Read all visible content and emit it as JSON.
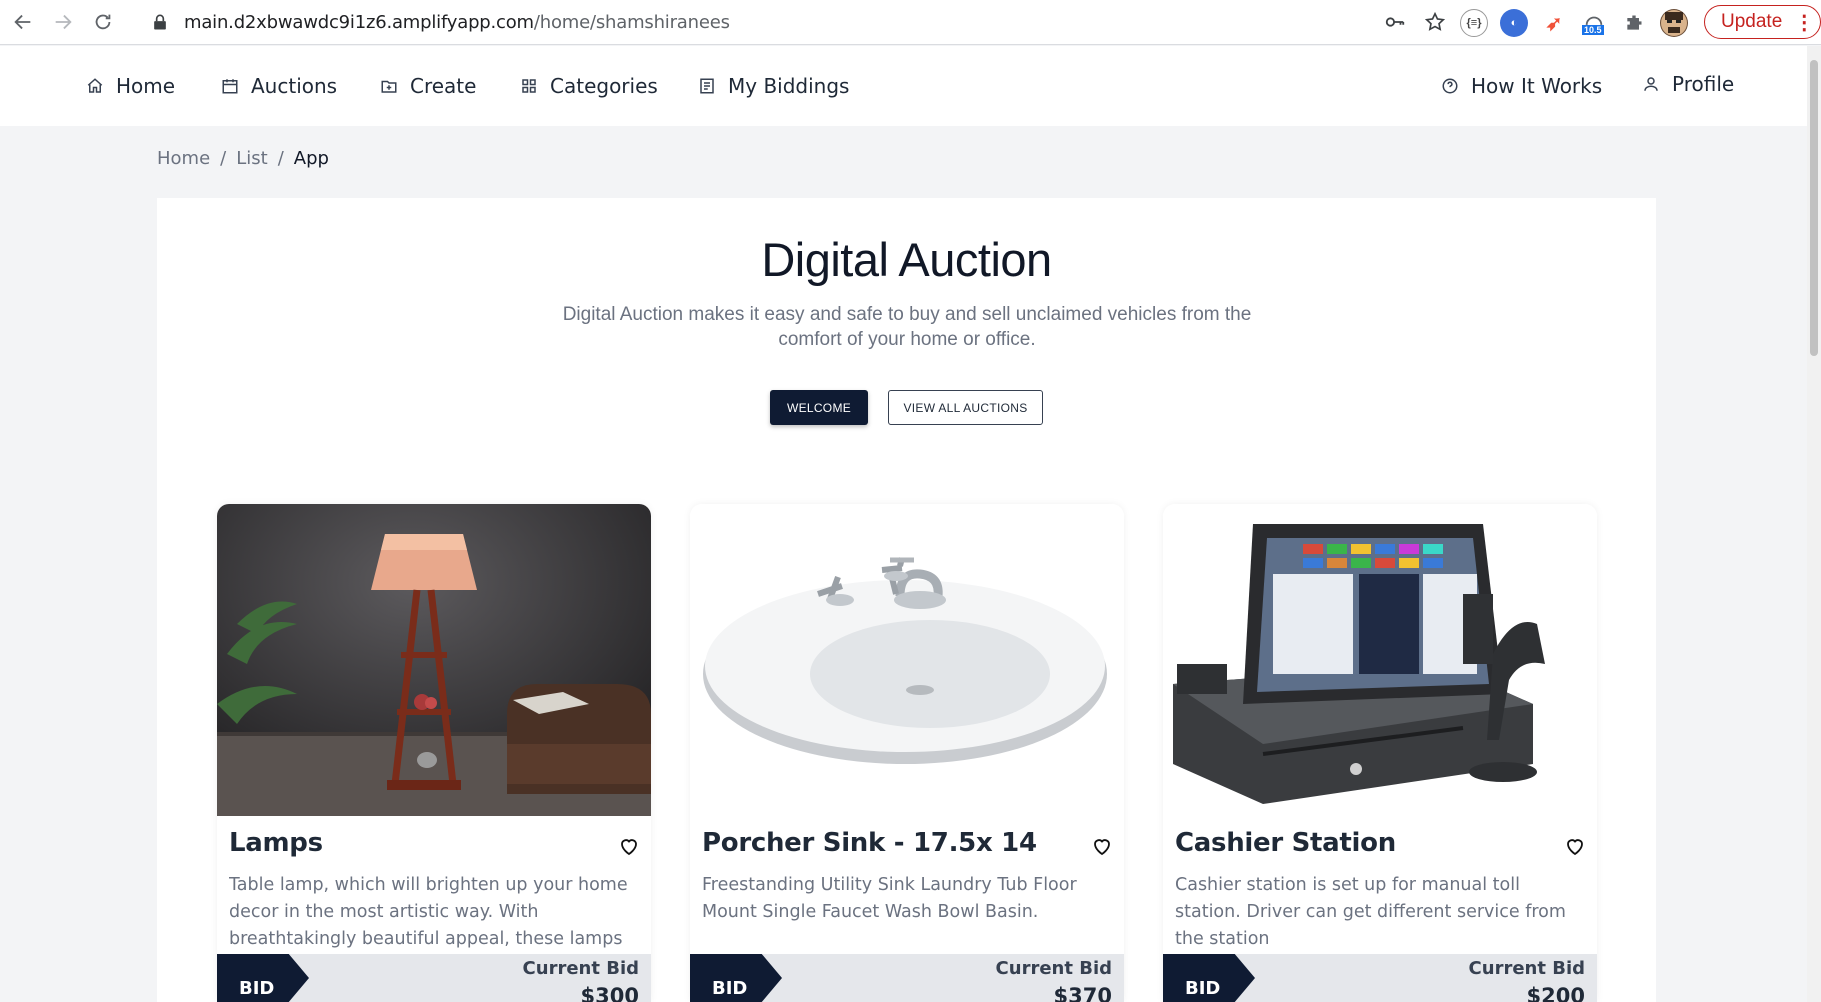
{
  "browser": {
    "url_host": "main.d2xbwawdc9i1z6.amplifyapp.com",
    "url_path": "/home/shamshiranees",
    "update_label": "Update",
    "extension_badge": "10.5"
  },
  "nav": {
    "items": [
      {
        "label": "Home",
        "icon": "home-icon"
      },
      {
        "label": "Auctions",
        "icon": "calendar-icon"
      },
      {
        "label": "Create",
        "icon": "folder-plus-icon"
      },
      {
        "label": "Categories",
        "icon": "grid-icon"
      },
      {
        "label": "My Biddings",
        "icon": "list-icon"
      }
    ],
    "right_items": [
      {
        "label": "How It Works",
        "icon": "help-circle-icon"
      },
      {
        "label": "Profile",
        "icon": "user-icon"
      }
    ]
  },
  "breadcrumb": {
    "items": [
      "Home",
      "List",
      "App"
    ],
    "separator": "/"
  },
  "hero": {
    "title": "Digital Auction",
    "subtitle": "Digital Auction makes it easy and safe to buy and sell unclaimed vehicles from the comfort of your home or office.",
    "primary_button": "WELCOME",
    "secondary_button": "VIEW ALL AUCTIONS"
  },
  "products": [
    {
      "title": "Lamps",
      "description": "Table lamp, which will brighten up your home decor in the most artistic way. With breathtakingly beautiful appeal, these lamps will complement",
      "bid_tag": "BID",
      "bid_label": "Current Bid",
      "bid_value": "$300"
    },
    {
      "title": "Porcher Sink - 17.5x 14",
      "description": "Freestanding Utility Sink Laundry Tub Floor Mount Single Faucet Wash Bowl Basin.",
      "bid_tag": "BID",
      "bid_label": "Current Bid",
      "bid_value": "$370"
    },
    {
      "title": "Cashier Station",
      "description": "Cashier station is set up for manual toll station. Driver can get different service from the station",
      "bid_tag": "BID",
      "bid_label": "Current Bid",
      "bid_value": "$200"
    }
  ],
  "colors": {
    "primary": "#0f1b33",
    "page_bg": "#f3f4f6",
    "update_red": "#c5221f"
  }
}
